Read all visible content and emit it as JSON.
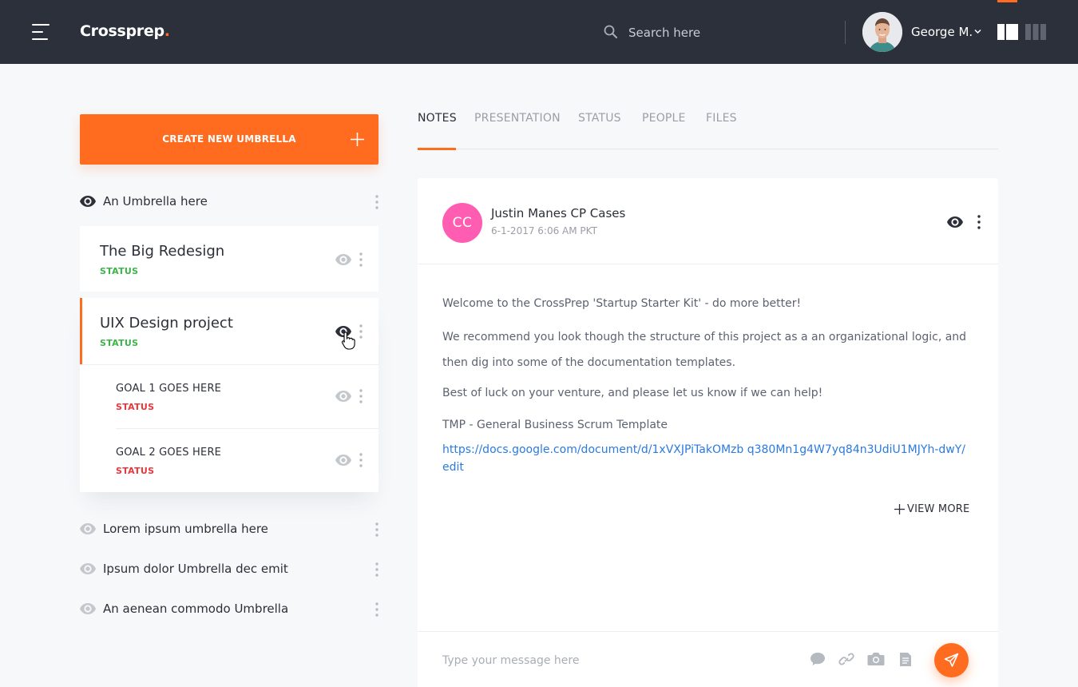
{
  "header": {
    "brand": "Crossprep",
    "brand_dot": ".",
    "search_placeholder": "Search here",
    "user_name": "George M.",
    "icons": [
      "menu-icon",
      "search-icon",
      "chevron-down-icon",
      "layout-split-icon",
      "layout-columns-icon"
    ]
  },
  "sidebar": {
    "create_button_label": "CREATE NEW UMBRELLA",
    "umbrellas": [
      {
        "label": "An Umbrella here"
      },
      {
        "label": "Lorem ipsum umbrella here"
      },
      {
        "label": "Ipsum dolor Umbrella dec emit"
      },
      {
        "label": "An aenean commodo Umbrella"
      }
    ],
    "projects": [
      {
        "title": "The Big Redesign",
        "status": "STATUS"
      },
      {
        "title": "UIX Design project",
        "status": "STATUS"
      }
    ],
    "goals": [
      {
        "title": "GOAL 1 GOES HERE",
        "status": "STATUS"
      },
      {
        "title": "GOAL 2 GOES HERE",
        "status": "STATUS"
      }
    ]
  },
  "tabs": [
    {
      "label": "NOTES",
      "active": true
    },
    {
      "label": "PRESENTATION",
      "active": false
    },
    {
      "label": "STATUS",
      "active": false
    },
    {
      "label": "PEOPLE",
      "active": false
    },
    {
      "label": "FILES",
      "active": false
    }
  ],
  "note": {
    "avatar_initials": "CC",
    "author": "Justin Manes CP Cases",
    "timestamp": "6-1-2017 6:06 AM PKT",
    "paragraphs": [
      "Welcome to the CrossPrep 'Startup Starter Kit' - do more better!",
      "We recommend you look though the structure of this project as a an organizational logic, and then dig into some of the documentation templates.",
      "Best of luck on your venture, and please let us know if we can help!",
      "TMP - General Business Scrum Template"
    ],
    "link": "https://docs.google.com/document/d/1xVXJPiTakOMzb q380Mn1g4W7yq84n3UdiU1MJYh-dwY/edit",
    "view_more": "VIEW MORE",
    "compose_placeholder": "Type your message here"
  },
  "colors": {
    "header_bg": "#2b303b",
    "accent": "#ff6b1f",
    "status_green": "#3cb44a",
    "status_red": "#e8373d",
    "link": "#2a7ae2",
    "avatar_pink": "#ff5db1"
  }
}
